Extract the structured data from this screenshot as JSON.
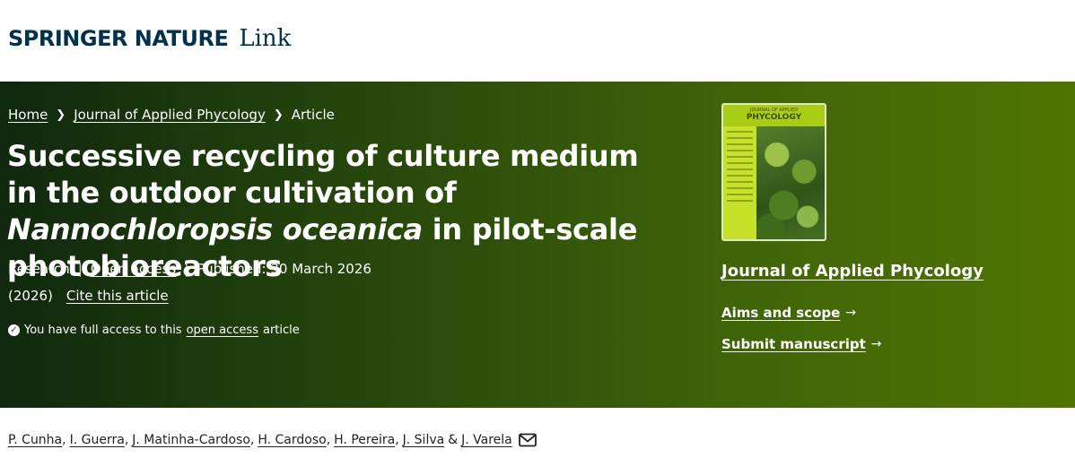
{
  "header": {
    "brand_main": "SPRINGER NATURE",
    "brand_link": "Link"
  },
  "breadcrumb": {
    "items": [
      "Home",
      "Journal of Applied Phycology",
      "Article"
    ]
  },
  "article": {
    "title_part1": "Successive recycling of culture medium in the outdoor cultivation of ",
    "title_italic1": "Nannochloropsis oceanica",
    "title_part2": " in pilot-scale photobioreactors",
    "type": "Research",
    "open_access": "Open access",
    "published": "Published: 30 March 2026",
    "year": "(2026)",
    "cite": "Cite this article",
    "access_prefix": "You have full access to this",
    "access_link": "open access",
    "access_suffix": "article"
  },
  "cover": {
    "top_small": "JOURNAL OF APPLIED",
    "top_big": "PHYCOLOGY"
  },
  "journal": {
    "title": "Journal of Applied Phycology",
    "aims": "Aims and scope",
    "submit": "Submit manuscript",
    "arrow": "→"
  },
  "authors": {
    "list": [
      "P. Cunha",
      "I. Guerra",
      "J. Matinha-Cardoso",
      "H. Cardoso",
      "H. Pereira",
      "J. Silva",
      "J. Varela"
    ],
    "conjunction": "&"
  },
  "icons": {
    "breadcrumb_separator": "chevron-right-icon",
    "access_check": "check-circle-icon",
    "author_contact": "mail-icon",
    "link_arrow": "arrow-right-icon"
  },
  "colors": {
    "brand": "#01324b",
    "hero_start": "#10280e",
    "hero_end": "#4f7402"
  }
}
